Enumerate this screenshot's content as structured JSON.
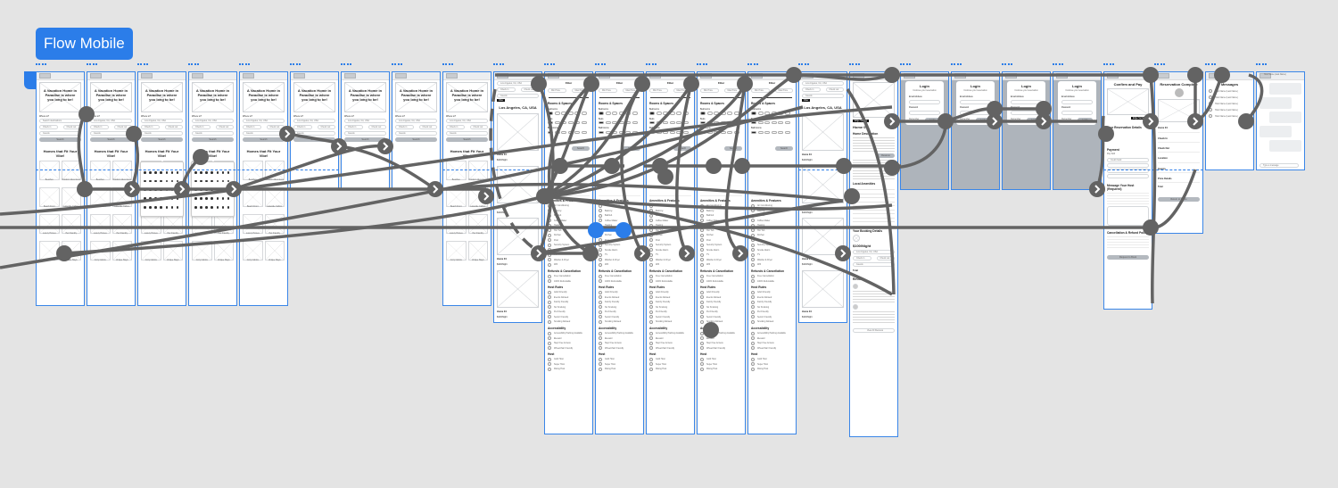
{
  "board": {
    "title": "Flow Mobile",
    "accent": "#2b7de9",
    "connector_color": "#636363",
    "selected_connector_color": "#2b7de9"
  },
  "home": {
    "hero": "A Vacation Home in Paradise is where you long to be!",
    "where_label": "Where to?",
    "where_placeholder": "Search destinations",
    "location_value": "Los Angeles, CA, USA",
    "check_in": "Check in",
    "check_out": "Check out",
    "guests": "Guests",
    "search": "Search",
    "section": "Homes that Fit Your Vibe!",
    "calendar_title": "Check In Date",
    "calendar_month": "May 2024",
    "categories": [
      "Beaches",
      "Outdoor Adventures",
      "Beach Front",
      "Lakeside Cabins",
      "Luxury Homes",
      "Pet Friendly",
      "Cozy Cabins",
      "Unique Stays"
    ]
  },
  "results": {
    "title": "Los Angeles, CA, USA",
    "filter": "Filter",
    "listing": "Home 04",
    "price": "$100/Night"
  },
  "filter": {
    "title": "Filter",
    "min": "Min Price",
    "max": "Max Price",
    "rooms": "Rooms & Spaces",
    "bedrooms": "Bedrooms",
    "beds": "Beds",
    "bathrooms": "Bathrooms",
    "amenities": "Amenities & Features",
    "amenity_items": [
      "Air Conditioning",
      "Balcony",
      "Bathtub",
      "Coffee Maker",
      "Heating",
      "Hot Tub",
      "Kitchen",
      "Pool",
      "Security System",
      "Smoke Alarm",
      "TV",
      "Washer & Dryer",
      "Wifi"
    ],
    "refunds": "Refunds & Cancellation",
    "refund_items": [
      "Free Cancellation",
      "100% Refundable"
    ],
    "rules": "Host Rules",
    "rule_items": [
      "Adult Friendly",
      "Events Allowed",
      "Family Friendly",
      "No Smoking",
      "Pet Friendly",
      "Senior Friendly",
      "Smoking Allowed"
    ],
    "accessibility": "Accessibility",
    "access_items": [
      "Accessibility Parking Available",
      "Elevator",
      "Step Free Access",
      "Wheelchair Friendly"
    ],
    "host": "Host",
    "host_items": [
      "Gold Host",
      "Super Host",
      "Rising Host"
    ],
    "apply": "Search"
  },
  "detail": {
    "badge": "Edge Section",
    "title": "Home 04",
    "description": "Home Description",
    "amenities": "Local Amenities",
    "booking": "Your Booking Details",
    "price": "$100/Night",
    "total": "Total",
    "reviews": "Reviews",
    "view_all": "View All Reviews",
    "reserve": "Reserve"
  },
  "login": {
    "title": "Login",
    "subtitle": "Continue your reservation",
    "email": "Email Address",
    "password": "Password",
    "forgot": "Forgot password?",
    "remember": "Remember",
    "button": "Login"
  },
  "confirm": {
    "title": "Confirm and Pay",
    "badge": "Edge Section",
    "details": "Your Reservation Details",
    "dates": "Dates",
    "guests": "Guests",
    "payment": "Payment",
    "pay_with": "Pay With",
    "card": "Credit Card",
    "message": "Message Your Host (Required)",
    "cancel": "Cancellation & Refund Policy",
    "button": "Request to Book"
  },
  "complete": {
    "title": "Reservation Complete",
    "home": "Home 04",
    "check_in": "Check In",
    "check_out": "Check Out",
    "location": "Location",
    "guests": "Guests",
    "price": "Price Details",
    "total": "Total",
    "button": "Return to Home"
  },
  "messages": {
    "title": "Messages",
    "host": "Host Name (Last Name)"
  },
  "chat": {
    "host": "Host Name (Last Name)",
    "input": "Type a message"
  }
}
